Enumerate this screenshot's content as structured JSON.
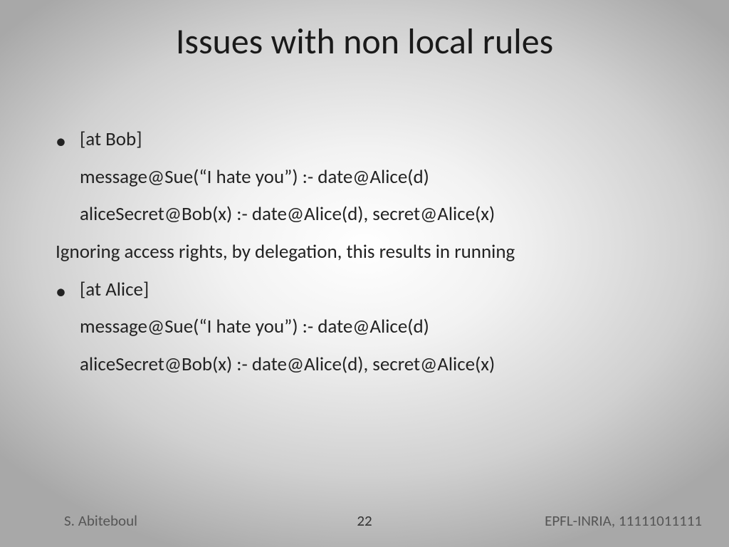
{
  "title": "Issues with non local rules",
  "body": {
    "bullet1": "[at Bob]",
    "line1": "message@Sue(“I hate you”) :- date@Alice(d)",
    "line2": "aliceSecret@Bob(x) :- date@Alice(d), secret@Alice(x)",
    "plain": "Ignoring access rights, by delegation, this results in running",
    "bullet2": "[at Alice]",
    "line3": "message@Sue(“I hate you”) :- date@Alice(d)",
    "line4": "aliceSecret@Bob(x) :- date@Alice(d), secret@Alice(x)"
  },
  "footer": {
    "left": "S. Abiteboul",
    "center": "22",
    "right": "EPFL-INRIA,  11111011111"
  }
}
